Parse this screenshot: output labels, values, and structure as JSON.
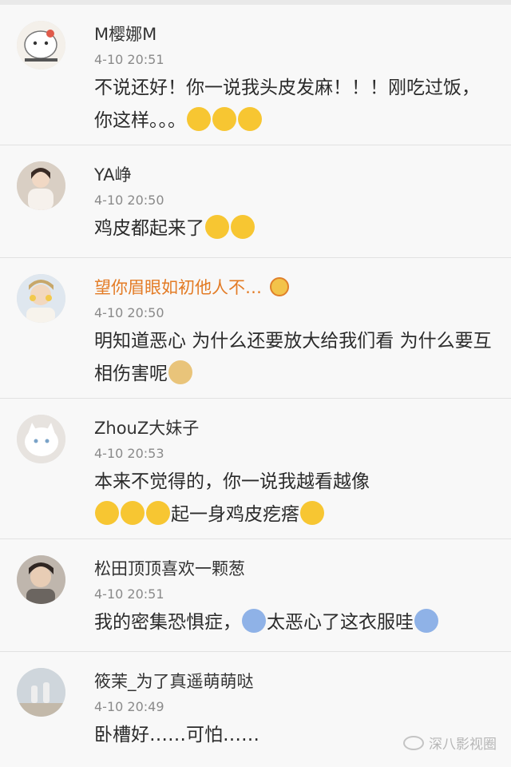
{
  "comments": [
    {
      "name": "M樱娜M",
      "time": "4-10 20:51",
      "text": "不说还好！你一说我头皮发麻！！！刚吃过饭，你这样。。。",
      "avatar_desc": "cartoon-cat-avatar",
      "emojis": [
        "sweat-face-emoji",
        "sweat-face-emoji",
        "sweat-face-emoji"
      ]
    },
    {
      "name": "YA峥",
      "time": "4-10 20:50",
      "text": "鸡皮都起来了",
      "avatar_desc": "photo-avatar",
      "emojis": [
        "shocked-face-emoji",
        "shocked-face-emoji"
      ]
    },
    {
      "name": "望你眉眼如初他人不…",
      "time": "4-10 20:50",
      "text": "明知道恶心 为什么还要放大给我们看  为什么要互相伤害呢",
      "avatar_desc": "photo-avatar",
      "vip": true,
      "emojis": [
        "doge-emoji"
      ]
    },
    {
      "name": "ZhouZ大妹子",
      "time": "4-10 20:53",
      "text": "本来不觉得的，你一说我越看越像",
      "text2": "起一身鸡皮疙瘩",
      "avatar_desc": "white-cat-avatar",
      "emojis": [
        "laugh-cry-emoji",
        "laugh-cry-emoji",
        "laugh-cry-emoji"
      ],
      "emojis2": [
        "laugh-cry-emoji"
      ]
    },
    {
      "name": "松田顶顶喜欢一颗葱",
      "time": "4-10 20:51",
      "text": "我的密集恐惧症，",
      "text2": "太恶心了这衣服哇",
      "avatar_desc": "photo-avatar",
      "emojis": [
        "scream-emoji"
      ],
      "emojis2": [
        "scream-emoji"
      ]
    },
    {
      "name": "筱茉_为了真遥萌萌哒",
      "time": "4-10 20:49",
      "text": "卧槽好……可怕……",
      "avatar_desc": "photo-avatar",
      "emojis": []
    }
  ],
  "watermark": "深八影视圈",
  "colors": {
    "background": "#f8f8f8",
    "divider": "#e2e2e2",
    "vip_name": "#e37b25",
    "time": "#8a8a8a"
  }
}
